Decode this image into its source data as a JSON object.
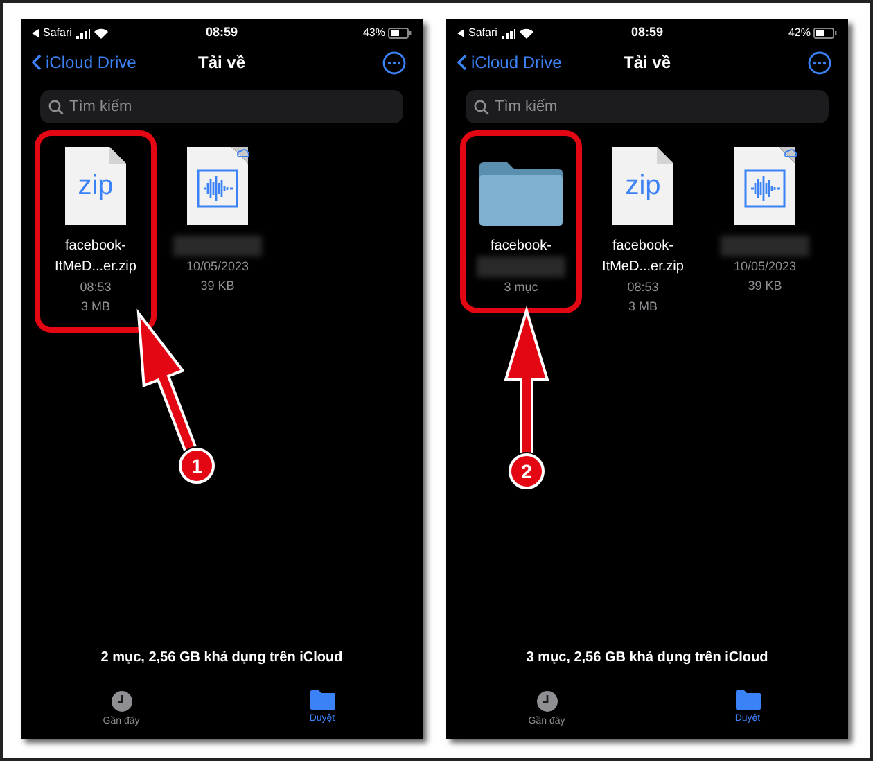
{
  "panels": [
    {
      "status": {
        "back_app": "Safari",
        "time": "08:59",
        "battery": "43%"
      },
      "nav": {
        "back": "iCloud Drive",
        "title": "Tải về"
      },
      "search": {
        "placeholder": "Tìm kiếm"
      },
      "files": [
        {
          "kind": "zip",
          "icon_label": "zip",
          "name": [
            "facebook-",
            "ItMeD...er.zip"
          ],
          "name_blurred": false,
          "date": "08:53",
          "size": "3 MB",
          "highlighted": true
        },
        {
          "kind": "audio",
          "name_blurred": true,
          "date": "10/05/2023",
          "size": "39 KB",
          "highlighted": false
        }
      ],
      "footer": "2 mục, 2,56 GB khả dụng trên iCloud",
      "tabs": [
        {
          "kind": "recent",
          "label": "Gần đây",
          "selected": false
        },
        {
          "kind": "browse",
          "label": "Duyệt",
          "selected": true
        }
      ],
      "annotation": {
        "number": "1"
      }
    },
    {
      "status": {
        "back_app": "Safari",
        "time": "08:59",
        "battery": "42%"
      },
      "nav": {
        "back": "iCloud Drive",
        "title": "Tải về"
      },
      "search": {
        "placeholder": "Tìm kiếm"
      },
      "files": [
        {
          "kind": "folder",
          "name": [
            "facebook-"
          ],
          "name_blurred": true,
          "count": "3 mục",
          "highlighted": true
        },
        {
          "kind": "zip",
          "icon_label": "zip",
          "name": [
            "facebook-",
            "ItMeD...er.zip"
          ],
          "name_blurred": false,
          "date": "08:53",
          "size": "3 MB",
          "highlighted": false
        },
        {
          "kind": "audio",
          "name_blurred": true,
          "date": "10/05/2023",
          "size": "39 KB",
          "highlighted": false
        }
      ],
      "footer": "3 mục, 2,56 GB khả dụng trên iCloud",
      "tabs": [
        {
          "kind": "recent",
          "label": "Gần đây",
          "selected": false
        },
        {
          "kind": "browse",
          "label": "Duyệt",
          "selected": true
        }
      ],
      "annotation": {
        "number": "2"
      }
    }
  ]
}
